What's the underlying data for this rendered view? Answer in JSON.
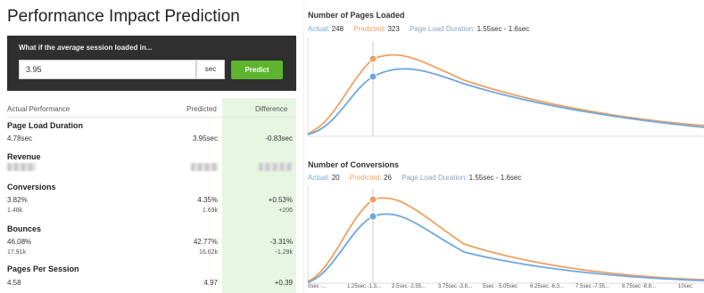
{
  "page_title": "Performance Impact Prediction",
  "whatif": {
    "label_prefix": "What if the",
    "label_emph": "average",
    "label_suffix": "session loaded in...",
    "input_value": "3.95",
    "unit": "sec",
    "button_label": "Predict"
  },
  "table": {
    "headers": {
      "actual": "Actual Performance",
      "predicted": "Predicted",
      "difference": "Difference"
    },
    "metrics": [
      {
        "name": "Page Load Duration",
        "actual": "4.78sec",
        "predicted": "3.95sec",
        "difference": "-0.83sec"
      },
      {
        "name": "Revenue"
      },
      {
        "name": "Conversions",
        "actual": "3.82%",
        "actual_sub": "1.48k",
        "predicted": "4.35%",
        "predicted_sub": "1.69k",
        "difference": "+0.53%",
        "difference_sub": "+206"
      },
      {
        "name": "Bounces",
        "actual": "46.08%",
        "actual_sub": "17.91k",
        "predicted": "42.77%",
        "predicted_sub": "16.62k",
        "difference": "-3.31%",
        "difference_sub": "-1.29k"
      },
      {
        "name": "Pages Per Session",
        "actual": "4.58",
        "predicted": "4.97",
        "difference": "+0.39"
      }
    ]
  },
  "colors": {
    "actual": "#6fa7e0",
    "predicted": "#f0a060",
    "range": "#8aa3bf",
    "accent_green": "#5db42e",
    "diff_bg": "#e6f6e1",
    "header_bg": "#2f2f2f"
  },
  "charts": [
    {
      "title": "Number of Pages Loaded",
      "legend": {
        "actual_label": "Actual:",
        "actual_value": "248",
        "predicted_label": "Predicted:",
        "predicted_value": "323",
        "range_label": "Page Load Duration:",
        "range_value": "1.55sec - 1.6sec"
      }
    },
    {
      "title": "Number of Conversions",
      "legend": {
        "actual_label": "Actual:",
        "actual_value": "20",
        "predicted_label": "Predicted:",
        "predicted_value": "26",
        "range_label": "Page Load Duration:",
        "range_value": "1.55sec - 1.6sec"
      }
    }
  ],
  "x_tick_labels": [
    "0sec -...",
    "1.25sec -1.3...",
    "2.5sec -2.55...",
    "3.75sec -3.8...",
    "5sec - 5.05sec",
    "6.25sec -6.3...",
    "7.5sec -7.55...",
    "8.75sec -8.8...",
    "10sec"
  ]
}
